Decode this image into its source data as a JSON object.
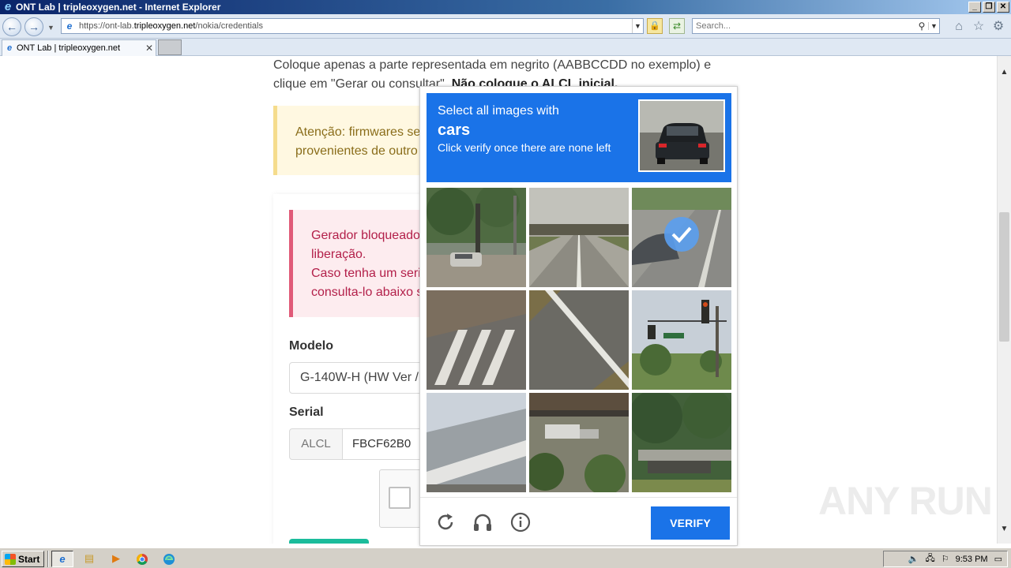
{
  "window": {
    "title": "ONT Lab | tripleoxygen.net - Internet Explorer",
    "colors": {
      "titlebar": "#0a246a",
      "accent": "#1a73e8"
    }
  },
  "address_bar": {
    "url_prefix": "https://ont-lab.",
    "url_domain": "tripleoxygen.net",
    "url_path": "/nokia/credentials",
    "search_placeholder": "Search..."
  },
  "tabs": [
    {
      "label": "ONT Lab | tripleoxygen.net"
    }
  ],
  "page": {
    "intro_text": "Coloque apenas a parte representada em negrito (AABBCCDD no exemplo) e clique em \"Gerar ou consultar\".",
    "intro_bold": "Não coloque o ALCL inicial.",
    "warning_text": "Atenção: firmwares ser\nprovenientes de outro",
    "blocked_text": "Gerador bloqueado\nliberação.\nCaso tenha um seria\nconsulta-lo abaixo s",
    "modelo_label": "Modelo",
    "modelo_value": "G-140W-H (HW Ver /",
    "serial_label": "Serial",
    "serial_prefix": "ALCL",
    "serial_value": "FBCF62B0"
  },
  "captcha": {
    "instruction_line1": "Select all images with",
    "target": "cars",
    "instruction_line3": "Click verify once there are none left",
    "verify_label": "VERIFY",
    "tiles": [
      {
        "scene": "street-with-car",
        "selected": false
      },
      {
        "scene": "highway-overpass",
        "selected": false
      },
      {
        "scene": "road-with-car",
        "selected": true
      },
      {
        "scene": "crosswalk",
        "selected": false
      },
      {
        "scene": "road-lane",
        "selected": false
      },
      {
        "scene": "traffic-light",
        "selected": false
      },
      {
        "scene": "bridge",
        "selected": false
      },
      {
        "scene": "overpass-with-van",
        "selected": false
      },
      {
        "scene": "bridge-trees",
        "selected": false
      }
    ]
  },
  "watermark": "ANY RUN",
  "taskbar": {
    "start_label": "Start",
    "clock": "9:53 PM"
  }
}
